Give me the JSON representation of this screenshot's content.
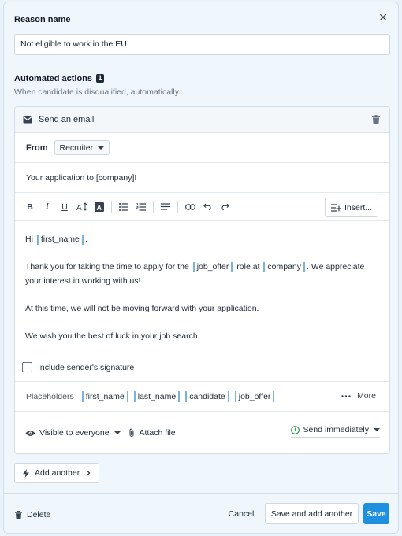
{
  "reason": {
    "title": "Reason name",
    "value": "Not eligible to work in the EU"
  },
  "automated": {
    "title": "Automated actions",
    "count": "1",
    "subtitle": "When candidate is disqualified, automatically..."
  },
  "action": {
    "header": "Send an email",
    "from_label": "From",
    "from_value": "Recruiter",
    "subject": "Your application to [company]!",
    "insert_label": "Insert...",
    "body": {
      "greet": "Hi",
      "greet_ph": "first_name",
      "greet_end": ",",
      "p1_a": "Thank you for taking the time to apply for the",
      "p1_ph1": "job_offer",
      "p1_b": "role at",
      "p1_ph2": "company",
      "p1_c": ". We appreciate your interest in working with us!",
      "p2": "At this time, we will not be moving forward with your application.",
      "p3": "We wish you the best of luck in your job search."
    },
    "signature_label": "Include sender's signature",
    "placeholders_label": "Placeholders",
    "placeholders": [
      "first_name",
      "last_name",
      "candidate",
      "job_offer"
    ],
    "more_label": "More",
    "visibility": "Visible to everyone",
    "attach": "Attach file",
    "send": "Send immediately"
  },
  "add_another": "Add another",
  "footer": {
    "delete": "Delete",
    "cancel": "Cancel",
    "save_add": "Save and add another",
    "save": "Save"
  }
}
